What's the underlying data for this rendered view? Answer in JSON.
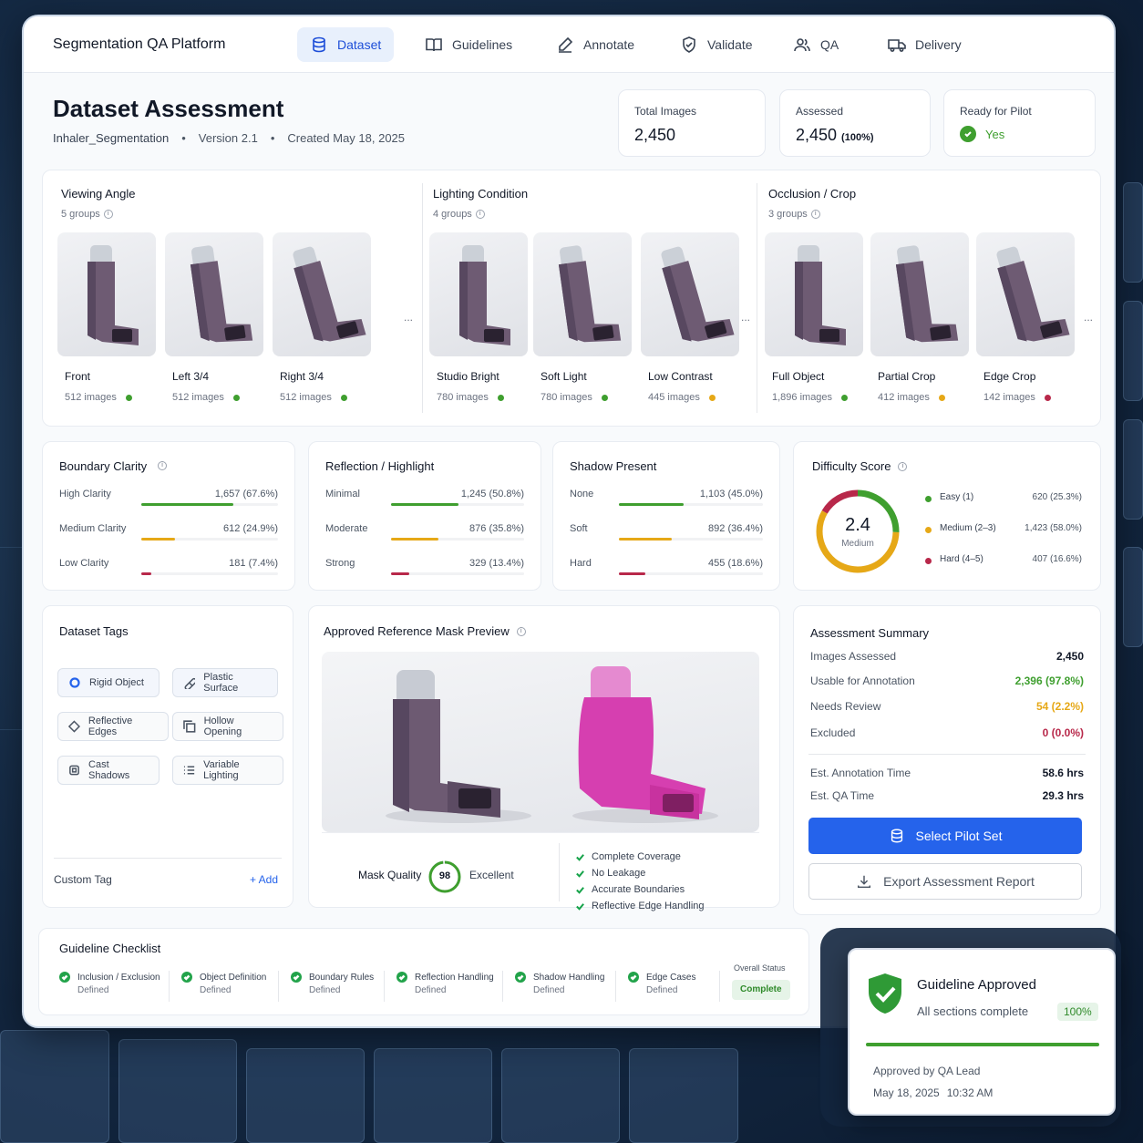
{
  "nav": {
    "brand": "Segmentation QA Platform",
    "tabs": [
      "Dataset",
      "Guidelines",
      "Annotate",
      "Validate",
      "QA",
      "Delivery"
    ],
    "active_tab": "Dataset"
  },
  "header": {
    "title": "Dataset Assessment",
    "dataset": "Inhaler_Segmentation",
    "version": "Version 2.1",
    "created": "Created May 18, 2025",
    "separator": "•"
  },
  "stats": {
    "total_label": "Total Images",
    "total_value": "2,450",
    "assessed_label": "Assessed",
    "assessed_value": "2,450",
    "assessed_pct": "(100%)",
    "ready_label": "Ready for Pilot",
    "ready_value": "Yes"
  },
  "groups": [
    {
      "title": "Viewing Angle",
      "count": "5 groups",
      "items": [
        {
          "name": "Front",
          "count": "512 images",
          "status": "#3f9f2f"
        },
        {
          "name": "Left 3/4",
          "count": "512 images",
          "status": "#3f9f2f"
        },
        {
          "name": "Right 3/4",
          "count": "512 images",
          "status": "#3f9f2f"
        }
      ]
    },
    {
      "title": "Lighting Condition",
      "count": "4 groups",
      "items": [
        {
          "name": "Studio Bright",
          "count": "780 images",
          "status": "#3f9f2f"
        },
        {
          "name": "Soft Light",
          "count": "780 images",
          "status": "#3f9f2f"
        },
        {
          "name": "Low Contrast",
          "count": "445 images",
          "status": "#e6a817"
        }
      ]
    },
    {
      "title": "Occlusion / Crop",
      "count": "3 groups",
      "items": [
        {
          "name": "Full Object",
          "count": "1,896 images",
          "status": "#3f9f2f"
        },
        {
          "name": "Partial Crop",
          "count": "412 images",
          "status": "#e6a817"
        },
        {
          "name": "Edge Crop",
          "count": "142 images",
          "status": "#b8284a"
        }
      ]
    }
  ],
  "ellipsis": "...",
  "metrics": [
    {
      "title": "Boundary Clarity",
      "rows": [
        {
          "label": "High Clarity",
          "value": "1,657",
          "pct": "(67.6%)",
          "fraction": 0.676,
          "color": "#3f9f2f"
        },
        {
          "label": "Medium Clarity",
          "value": "612",
          "pct": "(24.9%)",
          "fraction": 0.249,
          "color": "#e6a817"
        },
        {
          "label": "Low Clarity",
          "value": "181",
          "pct": "(7.4%)",
          "fraction": 0.074,
          "color": "#b8284a"
        }
      ]
    },
    {
      "title": "Reflection / Highlight",
      "rows": [
        {
          "label": "Minimal",
          "value": "1,245",
          "pct": "(50.8%)",
          "fraction": 0.508,
          "color": "#3f9f2f"
        },
        {
          "label": "Moderate",
          "value": "876",
          "pct": "(35.8%)",
          "fraction": 0.358,
          "color": "#e6a817"
        },
        {
          "label": "Strong",
          "value": "329",
          "pct": "(13.4%)",
          "fraction": 0.134,
          "color": "#b8284a"
        }
      ]
    },
    {
      "title": "Shadow Present",
      "rows": [
        {
          "label": "None",
          "value": "1,103",
          "pct": "(45.0%)",
          "fraction": 0.45,
          "color": "#3f9f2f"
        },
        {
          "label": "Soft",
          "value": "892",
          "pct": "(36.4%)",
          "fraction": 0.364,
          "color": "#e6a817"
        },
        {
          "label": "Hard",
          "value": "455",
          "pct": "(18.6%)",
          "fraction": 0.186,
          "color": "#b8284a"
        }
      ]
    }
  ],
  "difficulty": {
    "title": "Difficulty Score",
    "score": "2.4",
    "level": "Medium",
    "rows": [
      {
        "label": "Easy (1)",
        "value": "620",
        "pct": "(25.3%)",
        "fraction": 0.253,
        "color": "#3f9f2f"
      },
      {
        "label": "Medium (2–3)",
        "value": "1,423",
        "pct": "(58.0%)",
        "fraction": 0.58,
        "color": "#e6a817"
      },
      {
        "label": "Hard (4–5)",
        "value": "407",
        "pct": "(16.6%)",
        "fraction": 0.166,
        "color": "#b8284a"
      }
    ]
  },
  "tags": {
    "title": "Dataset Tags",
    "items": [
      {
        "label": "Rigid Object",
        "icon": "circle-icon",
        "highlight": true
      },
      {
        "label": "Plastic Surface",
        "icon": "pill-icon",
        "highlight": true
      },
      {
        "label": "Reflective Edges",
        "icon": "diamond-icon",
        "highlight": false
      },
      {
        "label": "Hollow Opening",
        "icon": "square-stack-icon",
        "highlight": false
      },
      {
        "label": "Cast Shadows",
        "icon": "layers-icon",
        "highlight": false
      },
      {
        "label": "Variable Lighting",
        "icon": "list-icon",
        "highlight": false
      }
    ],
    "custom_label": "Custom Tag",
    "add_label": "+ Add"
  },
  "mask": {
    "title": "Approved Reference Mask Preview",
    "quality_label": "Mask Quality",
    "quality_score": "98",
    "quality_fraction": 0.98,
    "quality_text": "Excellent",
    "checks": [
      "Complete Coverage",
      "No Leakage",
      "Accurate Boundaries",
      "Reflective Edge Handling"
    ]
  },
  "summary": {
    "title": "Assessment Summary",
    "rows": [
      {
        "label": "Images Assessed",
        "value": "2,450",
        "color": "#111827"
      },
      {
        "label": "Usable for Annotation",
        "value": "2,396  (97.8%)",
        "color": "#3f9f2f"
      },
      {
        "label": "Needs Review",
        "value": "54  (2.2%)",
        "color": "#e6a817"
      },
      {
        "label": "Excluded",
        "value": "0  (0.0%)",
        "color": "#b8284a"
      }
    ],
    "time_rows": [
      {
        "label": "Est. Annotation Time",
        "value": "58.6 hrs"
      },
      {
        "label": "Est. QA Time",
        "value": "29.3 hrs"
      }
    ],
    "primary_button": "Select Pilot Set",
    "secondary_button": "Export Assessment Report"
  },
  "checklist": {
    "title": "Guideline Checklist",
    "items": [
      {
        "name": "Inclusion / Exclusion",
        "status": "Defined"
      },
      {
        "name": "Object Definition",
        "status": "Defined"
      },
      {
        "name": "Boundary Rules",
        "status": "Defined"
      },
      {
        "name": "Reflection Handling",
        "status": "Defined"
      },
      {
        "name": "Shadow Handling",
        "status": "Defined"
      },
      {
        "name": "Edge Cases",
        "status": "Defined"
      }
    ],
    "overall_label": "Overall Status",
    "overall_value": "Complete"
  },
  "approval": {
    "title": "Guideline Approved",
    "subtitle": "All sections complete",
    "pct": "100%",
    "fraction": 1.0,
    "by": "Approved by QA Lead",
    "date": "May 18, 2025",
    "time": "10:32 AM"
  },
  "colors": {
    "primary": "#2563eb",
    "good": "#3f9f2f",
    "warn": "#e6a817",
    "bad": "#b8284a",
    "mask": "#d63fb0"
  }
}
